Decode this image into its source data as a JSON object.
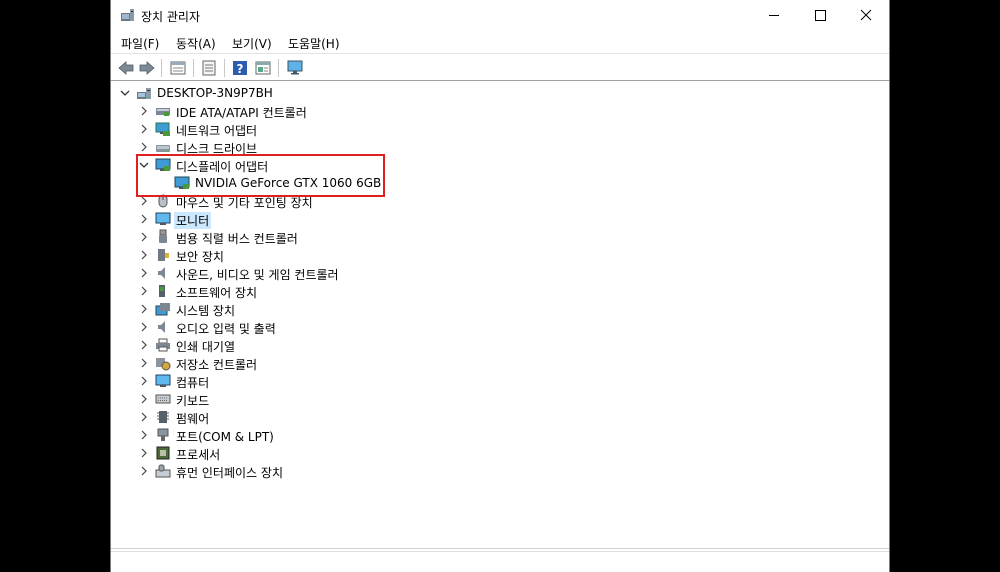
{
  "window": {
    "title": "장치 관리자",
    "controls": {
      "minimize": "minimize",
      "maximize": "maximize",
      "close": "close"
    }
  },
  "menu": [
    "파일(F)",
    "동작(A)",
    "보기(V)",
    "도움말(H)"
  ],
  "toolbar": [
    "back-icon",
    "forward-icon",
    "properties-grid-icon",
    "list-icon",
    "help-icon",
    "details-icon",
    "monitor-scan-icon"
  ],
  "tree": {
    "root": {
      "label": "DESKTOP-3N9P7BH",
      "expanded": true,
      "icon": "computer-icon"
    },
    "categories": [
      {
        "label": "IDE ATA/ATAPI 컨트롤러",
        "icon": "ide-controller-icon"
      },
      {
        "label": "네트워크 어댑터",
        "icon": "network-adapter-icon"
      },
      {
        "label": "디스크 드라이브",
        "icon": "disk-drive-icon"
      },
      {
        "label": "디스플레이 어댑터",
        "icon": "display-adapter-icon",
        "expanded": true,
        "children": [
          {
            "label": "NVIDIA GeForce GTX 1060 6GB",
            "icon": "display-adapter-icon"
          }
        ]
      },
      {
        "label": "마우스 및 기타 포인팅 장치",
        "icon": "mouse-icon"
      },
      {
        "label": "모니터",
        "icon": "monitor-icon",
        "selected": true
      },
      {
        "label": "범용 직렬 버스 컨트롤러",
        "icon": "usb-icon"
      },
      {
        "label": "보안 장치",
        "icon": "security-device-icon"
      },
      {
        "label": "사운드, 비디오 및 게임 컨트롤러",
        "icon": "speaker-icon"
      },
      {
        "label": "소프트웨어 장치",
        "icon": "software-device-icon"
      },
      {
        "label": "시스템 장치",
        "icon": "system-device-icon"
      },
      {
        "label": "오디오 입력 및 출력",
        "icon": "audio-io-icon"
      },
      {
        "label": "인쇄 대기열",
        "icon": "printer-icon"
      },
      {
        "label": "저장소 컨트롤러",
        "icon": "storage-controller-icon"
      },
      {
        "label": "컴퓨터",
        "icon": "computer-monitor-icon"
      },
      {
        "label": "키보드",
        "icon": "keyboard-icon"
      },
      {
        "label": "펌웨어",
        "icon": "firmware-icon"
      },
      {
        "label": "포트(COM & LPT)",
        "icon": "port-icon"
      },
      {
        "label": "프로세서",
        "icon": "processor-icon"
      },
      {
        "label": "휴먼 인터페이스 장치",
        "icon": "hid-icon"
      }
    ]
  },
  "colors": {
    "highlight_box": "#e02020",
    "selection": "#cce8ff",
    "window_frame": "#7a7a7a"
  }
}
